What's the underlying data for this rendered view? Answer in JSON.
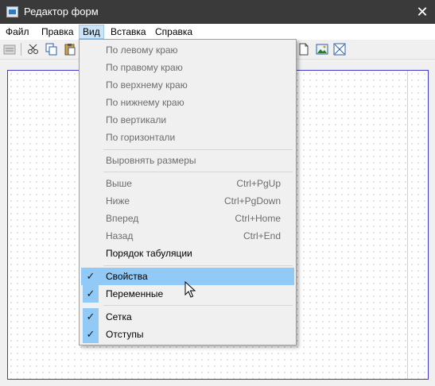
{
  "window": {
    "title": "Редактор форм",
    "close_glyph": "✕"
  },
  "menubar": {
    "items": [
      "Файл",
      "Правка",
      "Вид",
      "Вставка",
      "Справка"
    ],
    "active_index": 2
  },
  "toolbar": {
    "icons": [
      "list-icon",
      "cut-icon",
      "copy-icon",
      "paste-icon",
      "page-icon",
      "picture-icon",
      "cross-box-icon"
    ]
  },
  "vid_menu": {
    "groups": [
      [
        {
          "label": "По левому краю",
          "enabled": false
        },
        {
          "label": "По правому краю",
          "enabled": false
        },
        {
          "label": "По верхнему краю",
          "enabled": false
        },
        {
          "label": "По нижнему краю",
          "enabled": false
        },
        {
          "label": "По вертикали",
          "enabled": false
        },
        {
          "label": "По горизонтали",
          "enabled": false
        }
      ],
      [
        {
          "label": "Выровнять размеры",
          "enabled": false
        }
      ],
      [
        {
          "label": "Выше",
          "shortcut": "Ctrl+PgUp",
          "enabled": false
        },
        {
          "label": "Ниже",
          "shortcut": "Ctrl+PgDown",
          "enabled": false
        },
        {
          "label": "Вперед",
          "shortcut": "Ctrl+Home",
          "enabled": false
        },
        {
          "label": "Назад",
          "shortcut": "Ctrl+End",
          "enabled": false
        },
        {
          "label": "Порядок табуляции",
          "enabled": true
        }
      ],
      [
        {
          "label": "Свойства",
          "enabled": true,
          "checked": true,
          "highlighted": true
        },
        {
          "label": "Переменные",
          "enabled": true,
          "checked": true
        }
      ],
      [
        {
          "label": "Сетка",
          "enabled": true,
          "checked": true
        },
        {
          "label": "Отступы",
          "enabled": true,
          "checked": true
        }
      ]
    ]
  },
  "colors": {
    "titlebar": "#3a3a3a",
    "menu_highlight": "#91c9f7",
    "canvas_border": "#3c3cc8",
    "disabled_text": "#6d6d6d"
  }
}
